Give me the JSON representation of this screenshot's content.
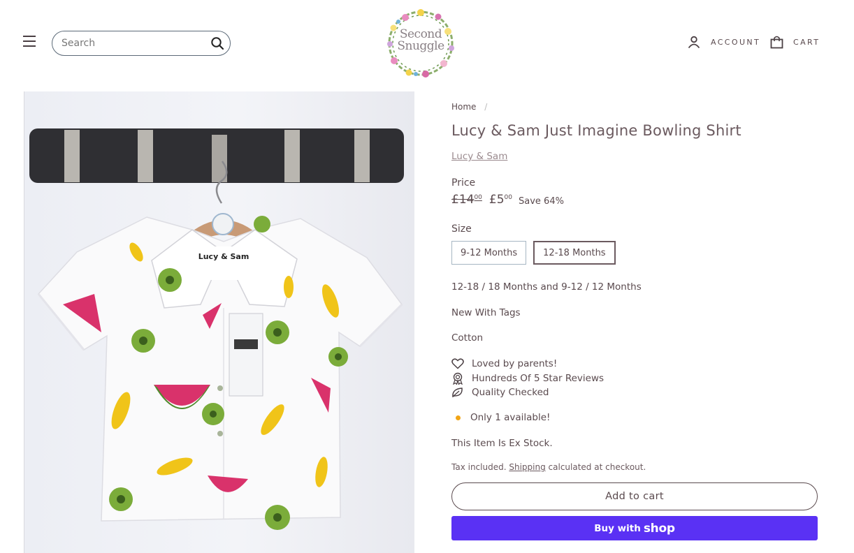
{
  "header": {
    "search_placeholder": "Search",
    "logo_line1": "Second",
    "logo_line2": "Snuggle",
    "account_label": "ACCOUNT",
    "cart_label": "CART"
  },
  "breadcrumb": {
    "home": "Home",
    "separator": "/"
  },
  "product": {
    "title": "Lucy & Sam Just Imagine Bowling Shirt",
    "vendor": "Lucy & Sam",
    "price_label": "Price",
    "old_price_main": "£14",
    "old_price_cents": "00",
    "new_price_main": "£5",
    "new_price_cents": "00",
    "save_text": "Save 64%",
    "size_label": "Size",
    "sizes": [
      "9-12 Months",
      "12-18 Months"
    ],
    "selected_size": "12-18 Months",
    "size_description": "12-18 / 18 Months and 9-12 / 12 Months",
    "condition": "New With Tags",
    "material": "Cotton",
    "features": [
      "Loved by parents!",
      "Hundreds Of 5 Star Reviews",
      "Quality Checked"
    ],
    "stock_text": "Only 1 available!",
    "ex_stock": "This Item Is Ex Stock.",
    "tax_prefix": "Tax included.",
    "tax_link": "Shipping",
    "tax_suffix": "calculated at checkout.",
    "add_to_cart": "Add to cart",
    "buy_with": "Buy with",
    "buy_brand": "shop"
  },
  "colors": {
    "accent_text": "#5a4a4e",
    "buy_button": "#5a31f4",
    "stock_dot": "#f2a516"
  },
  "icons": [
    "menu-icon",
    "search-icon",
    "user-icon",
    "bag-icon",
    "heart-icon",
    "award-icon",
    "leaf-icon"
  ]
}
